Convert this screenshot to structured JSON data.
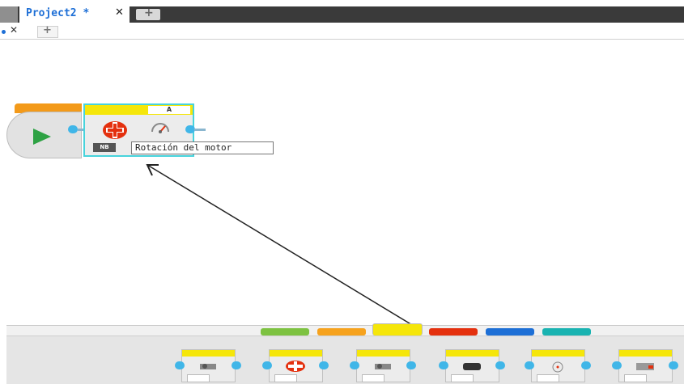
{
  "tabs": {
    "project_title": "Project2 *",
    "project_close": "✕",
    "add_tab": "+",
    "sub_close": "✕",
    "sub_add": "+"
  },
  "canvas": {
    "motor_block": {
      "port": "A",
      "mode_label": "NB"
    },
    "tooltip": "Rotación del motor"
  },
  "icons": {
    "start": "play-icon",
    "motor": "large-motor-icon",
    "rotation": "rotation-gauge-icon"
  },
  "palette": {
    "category_colors": [
      "#7dc241",
      "#f6a21d",
      "#f5e60a",
      "#e4300e",
      "#1d6fd6",
      "#19b3b1"
    ],
    "selected_category": 2,
    "blocks": [
      "medium-motor",
      "large-motor",
      "move-steering",
      "move-tank",
      "display",
      "sound"
    ]
  },
  "colors": {
    "accent_blue": "#1e6fd6",
    "selection_cyan": "#47d3dc",
    "action_yellow": "#f5e60a",
    "start_orange": "#f39a1a",
    "play_green": "#2ea244"
  }
}
